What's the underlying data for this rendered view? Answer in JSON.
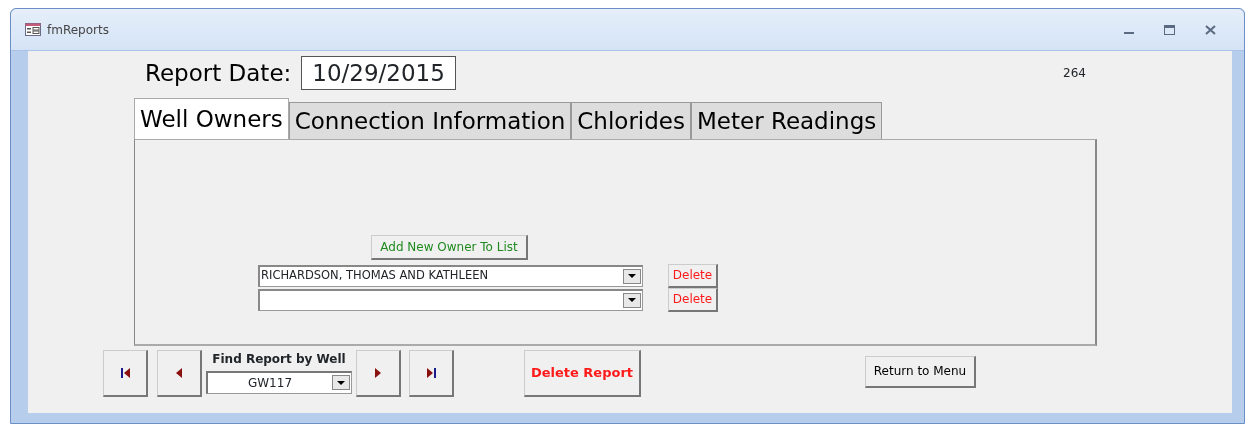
{
  "window": {
    "title": "fmReports"
  },
  "report_date": {
    "label": "Report Date:",
    "value": "10/29/2015"
  },
  "record_number": "264",
  "tabs": [
    {
      "label": "Well Owners",
      "selected": true
    },
    {
      "label": "Connection Information",
      "selected": false
    },
    {
      "label": "Chlorides",
      "selected": false
    },
    {
      "label": "Meter Readings",
      "selected": false
    }
  ],
  "add_owner_button": "Add New Owner To List",
  "owners": [
    {
      "value": "RICHARDSON, THOMAS AND KATHLEEN",
      "delete_label": "Delete"
    },
    {
      "delete_label": "Delete"
    }
  ],
  "navigation": {
    "find_label": "Find Report by Well",
    "find_value": "GW117"
  },
  "delete_report_button": "Delete Report",
  "return_button": "Return to Menu"
}
